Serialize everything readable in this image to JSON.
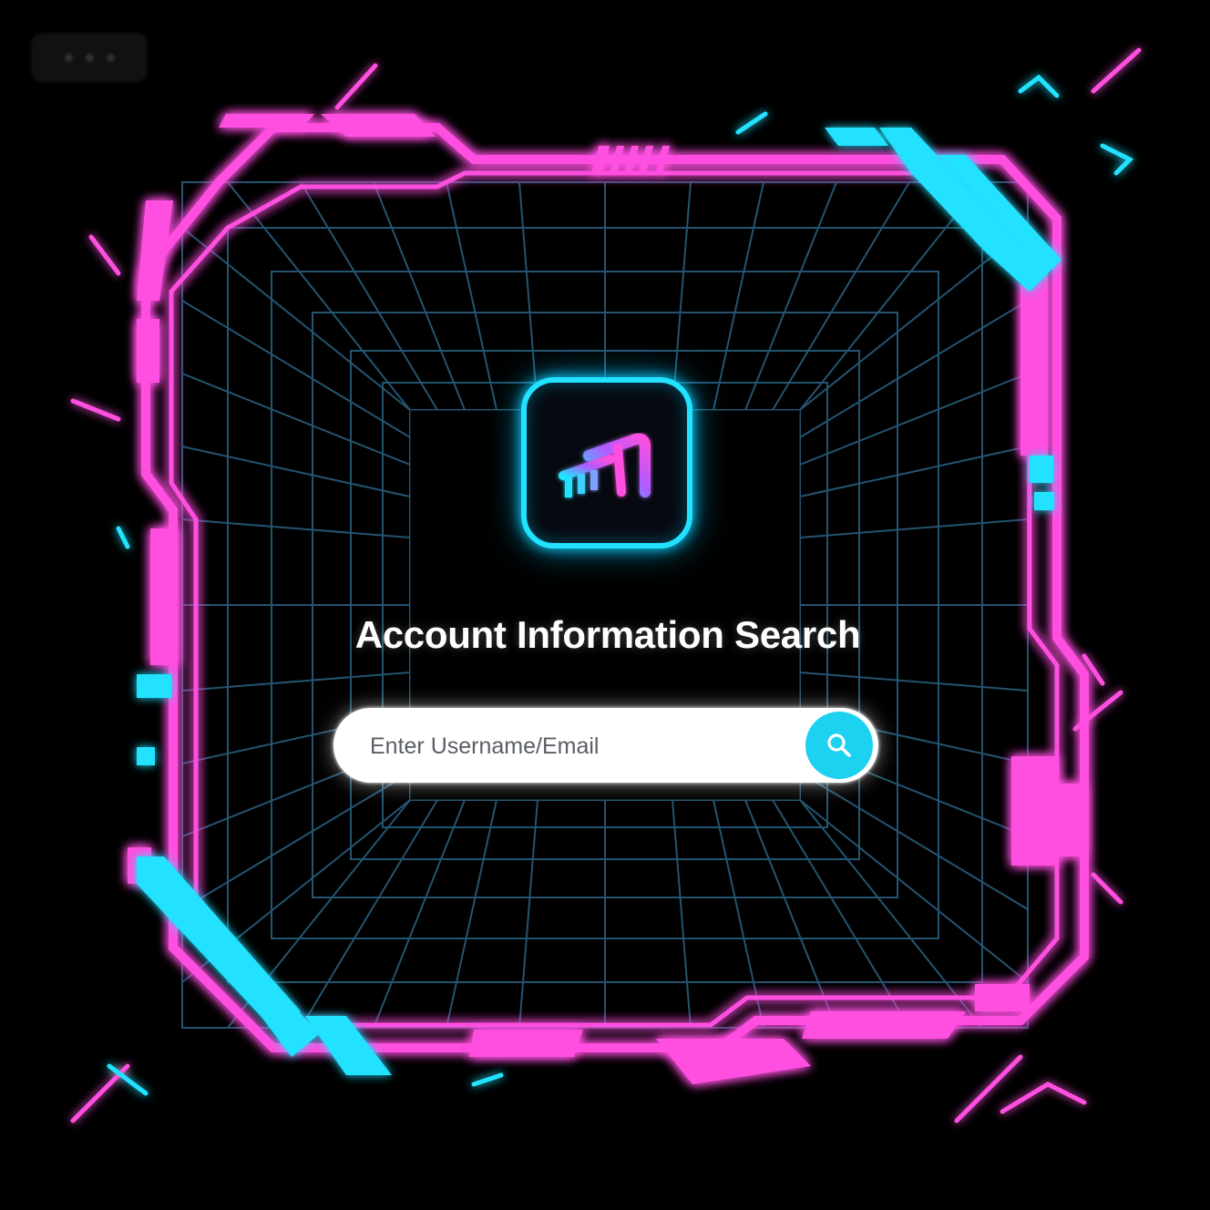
{
  "app": {
    "logo_icon": "neon-arrow-a-icon",
    "title": "Account Information Search"
  },
  "search": {
    "placeholder": "Enter Username/Email",
    "value": "",
    "button_icon": "search-icon"
  },
  "theme": {
    "background": "#000000",
    "accent_pink": "#ff4fe0",
    "accent_cyan": "#22e2ff",
    "grid_line": "#2a5a7a",
    "search_button": "#1cd2f0"
  }
}
